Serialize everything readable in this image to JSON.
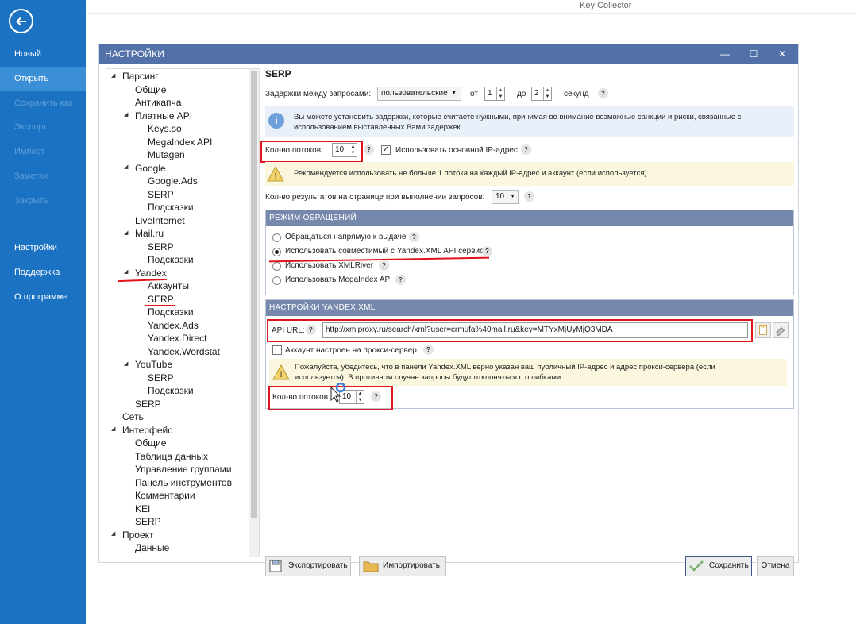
{
  "window_title": "Key Collector",
  "sidebar": {
    "items": [
      {
        "label": "Новый"
      },
      {
        "label": "Открыть"
      },
      {
        "label": "Сохранить как"
      },
      {
        "label": "Экспорт"
      },
      {
        "label": "Импорт"
      },
      {
        "label": "Заметки"
      },
      {
        "label": "Закрыть"
      },
      {
        "label": "Настройки"
      },
      {
        "label": "Поддержка"
      },
      {
        "label": "О программе"
      }
    ]
  },
  "dialog": {
    "title": "НАСТРОЙКИ",
    "controls": {
      "minimize": "—",
      "maximize": "☐",
      "close": "✕"
    }
  },
  "tree": [
    "Парсинг",
    "Общие",
    "Антикапча",
    "Платные API",
    "Keys.so",
    "MegaIndex API",
    "Mutagen",
    "Google",
    "Google.Ads",
    "SERP",
    "Подсказки",
    "LiveInternet",
    "Mail.ru",
    "SERP",
    "Подсказки",
    "Yandex",
    "Аккаунты",
    "SERP",
    "Подсказки",
    "Yandex.Ads",
    "Yandex.Direct",
    "Yandex.Wordstat",
    "YouTube",
    "SERP",
    "Подсказки",
    "SERP",
    "Сеть",
    "Интерфейс",
    "Общие",
    "Таблица данных",
    "Управление группами",
    "Панель инструментов",
    "Комментарии",
    "KEI",
    "SERP",
    "Проект",
    "Данные"
  ],
  "serp": {
    "heading": "SERP",
    "delays_label": "Задержки между запросами:",
    "delays_mode": "пользовательские",
    "from_label": "от",
    "from_value": "1",
    "to_label": "до",
    "to_value": "2",
    "seconds_label": "секунд",
    "info_text_1": "Вы можете установить задержки, которые считаете нужными, принимая во внимание возможные санкции и риски, связанные с",
    "info_text_2": "использованием выставленных Вами задержек.",
    "threads_label": "Кол-во потоков:",
    "threads_value": "10",
    "use_main_ip_label": "Использовать основной IP-адрес",
    "use_main_ip_checked": true,
    "warn_text": "Рекомендуется использовать не больше 1 потока на каждый IP-адрес и аккаунт (если используется).",
    "results_label": "Кол-во результатов на странице при выполнении запросов:",
    "results_value": "10"
  },
  "mode_section": {
    "title": "РЕЖИМ ОБРАЩЕНИЙ",
    "options": [
      {
        "label": "Обращаться напрямую к выдаче",
        "selected": false
      },
      {
        "label": "Использовать совместимый с Yandex.XML API сервис",
        "selected": true
      },
      {
        "label": "Использовать XMLRiver",
        "selected": false
      },
      {
        "label": "Использовать MegaIndex API",
        "selected": false
      }
    ]
  },
  "yandex_xml": {
    "title": "НАСТРОЙКИ YANDEX.XML",
    "api_url_label": "API URL:",
    "api_url_value": "http://xmlproxy.ru/search/xml?user=crmufa%40mail.ru&key=MTYxMjUyMjQ3MDA",
    "proxy_label": "Аккаунт настроен на прокси-сервер",
    "proxy_checked": false,
    "warn_text_1": "Пожалуйста, убедитесь, что в панели Yandex.XML верно указан ваш публичный IP-адрес и адрес прокси-сервера (если",
    "warn_text_2": "используется). В противном случае запросы будут отклоняться с ошибками.",
    "threads_label": "Кол-во потоков",
    "threads_value": "10"
  },
  "footer": {
    "export_label": "Экспортировать",
    "import_label": "Импортировать",
    "save_label": "Сохранить",
    "cancel_label": "Отмена"
  },
  "help_glyph": "?"
}
